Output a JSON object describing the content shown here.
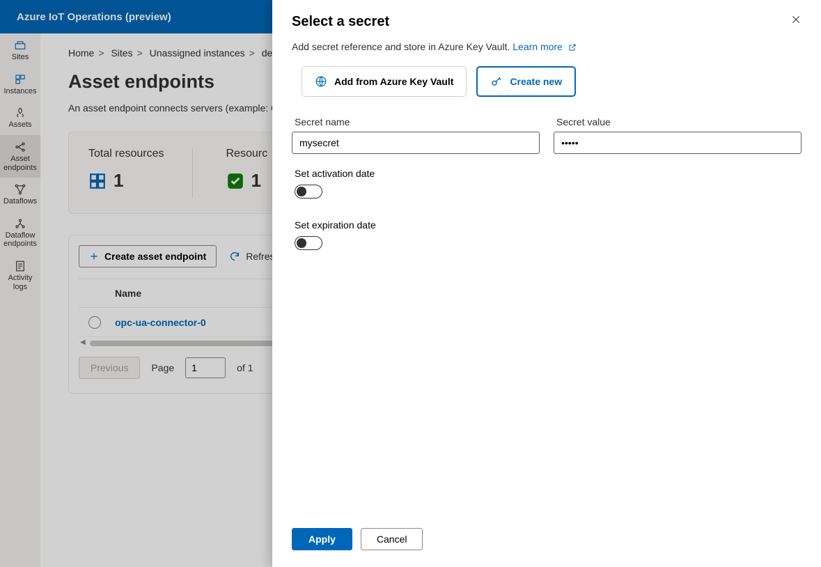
{
  "topbar": {
    "title": "Azure IoT Operations (preview)"
  },
  "nav": {
    "sites": "Sites",
    "instances": "Instances",
    "assets": "Assets",
    "asset_endpoints": "Asset endpoints",
    "dataflows": "Dataflows",
    "dataflow_endpoints": "Dataflow endpoints",
    "activity_logs": "Activity logs"
  },
  "breadcrumb": {
    "home": "Home",
    "sites": "Sites",
    "unassigned": "Unassigned instances",
    "default": "default"
  },
  "page": {
    "title": "Asset endpoints",
    "subtitle": "An asset endpoint connects servers (example: O"
  },
  "stats": {
    "total_label": "Total resources",
    "total_value": "1",
    "res_label": "Resourc",
    "res_value": "1"
  },
  "toolbar": {
    "create": "Create asset endpoint",
    "refresh": "Refres"
  },
  "table": {
    "col_name": "Name",
    "row0": {
      "name": "opc-ua-connector-0"
    }
  },
  "pager": {
    "previous": "Previous",
    "page_label": "Page",
    "page_value": "1",
    "of": "of 1"
  },
  "panel": {
    "title": "Select a secret",
    "subtitle": "Add secret reference and store in Azure Key Vault. ",
    "learn_more": "Learn more ",
    "add_from_kv": "Add from Azure Key Vault",
    "create_new": "Create new",
    "secret_name_label": "Secret name",
    "secret_name_value": "mysecret",
    "secret_value_label": "Secret value",
    "secret_value_value": "•••••",
    "activation_label": "Set activation date",
    "expiration_label": "Set expiration date",
    "apply": "Apply",
    "cancel": "Cancel"
  }
}
